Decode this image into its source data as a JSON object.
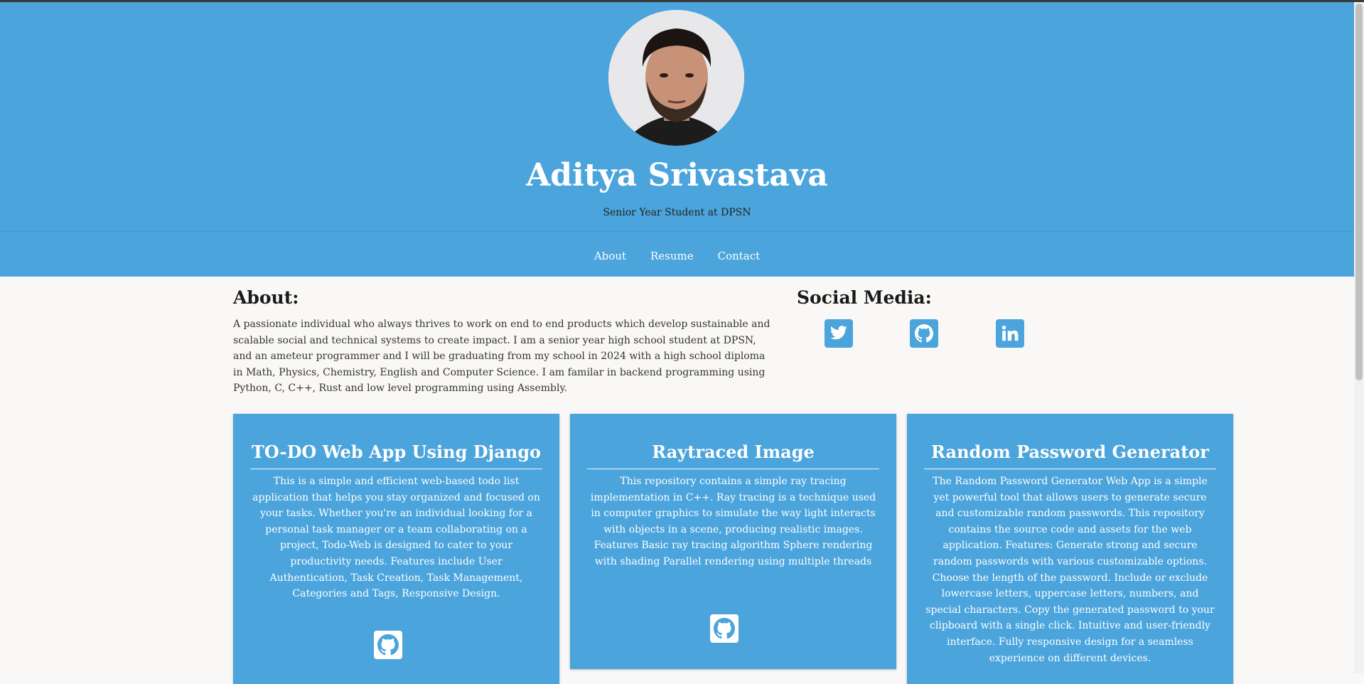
{
  "profile": {
    "name": "Aditya Srivastava",
    "tagline": "Senior Year Student at DPSN"
  },
  "nav": {
    "items": [
      "About",
      "Resume",
      "Contact"
    ]
  },
  "about": {
    "heading": "About:",
    "body": "A passionate individual who always thrives to work on end to end products which develop sustainable and scalable social and technical systems to create impact. I am a senior year high school student at DPSN, and an ameteur programmer and I will be graduating from my school in 2024 with a high school diploma in Math, Physics, Chemistry, English and Computer Science. I am familar in backend programming using Python, C, C++, Rust and low level programming using Assembly."
  },
  "social": {
    "heading": "Social Media:",
    "icons": [
      "twitter-icon",
      "github-icon",
      "linkedin-icon"
    ]
  },
  "projects": [
    {
      "title": "TO-DO Web App Using Django",
      "description": "This is a simple and efficient web-based todo list application that helps you stay organized and focused on your tasks. Whether you're an individual looking for a personal task manager or a team collaborating on a project, Todo-Web is designed to cater to your productivity needs. Features include User Authentication, Task Creation, Task Management, Categories and Tags, Responsive Design.",
      "icon": "github-icon"
    },
    {
      "title": "Raytraced Image",
      "description": "This repository contains a simple ray tracing implementation in C++. Ray tracing is a technique used in computer graphics to simulate the way light interacts with objects in a scene, producing realistic images. Features Basic ray tracing algorithm Sphere rendering with shading Parallel rendering using multiple threads",
      "icon": "github-icon"
    },
    {
      "title": "Random Password Generator",
      "description": "The Random Password Generator Web App is a simple yet powerful tool that allows users to generate secure and customizable random passwords. This repository contains the source code and assets for the web application. Features: Generate strong and secure random passwords with various customizable options. Choose the length of the password. Include or exclude lowercase letters, uppercase letters, numbers, and special characters. Copy the generated password to your clipboard with a single click. Intuitive and user-friendly interface. Fully responsive design for a seamless experience on different devices."
    }
  ],
  "colors": {
    "accent": "#4ba4dc",
    "background": "#f9f8f6",
    "text": "#333333"
  }
}
